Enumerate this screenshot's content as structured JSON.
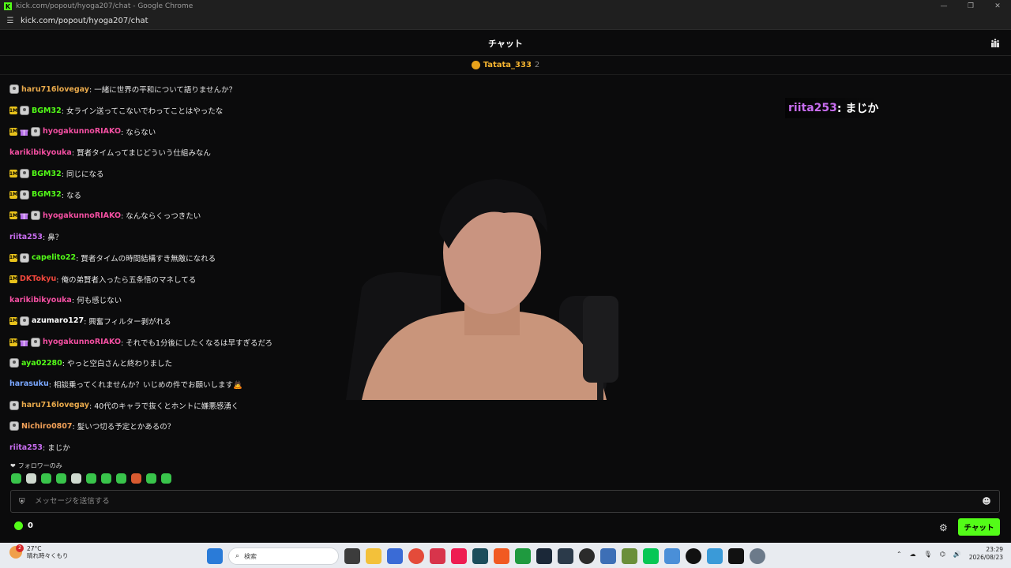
{
  "window": {
    "title": "kick.com/popout/hyoga207/chat - Google Chrome",
    "url": "kick.com/popout/hyoga207/chat"
  },
  "chat": {
    "title": "チャット",
    "pinned": {
      "user": "Tatata_333",
      "count": "2"
    },
    "messages": [
      {
        "user": "haru716lovegay",
        "text": ": 一緒に世界の平和について語りませんか？",
        "color": "#e8a94b",
        "sub": false,
        "gift": false,
        "avatar": true
      },
      {
        "user": "BGM32",
        "text": ": 女ライン送ってこないでわってことはやったな",
        "color": "#53fc18",
        "sub": true,
        "gift": false,
        "avatar": true
      },
      {
        "user": "hyogakunnoRIAKO",
        "text": ": ならない",
        "color": "#f24fa1",
        "sub": true,
        "gift": true,
        "avatar": true
      },
      {
        "user": "karikibikyouka",
        "text": ": 賢者タイムってまじどういう仕組みなん",
        "color": "#f24fa1",
        "sub": false,
        "gift": false,
        "avatar": false
      },
      {
        "user": "BGM32",
        "text": ": 同じになる",
        "color": "#53fc18",
        "sub": true,
        "gift": false,
        "avatar": true
      },
      {
        "user": "BGM32",
        "text": ": なる",
        "color": "#53fc18",
        "sub": true,
        "gift": false,
        "avatar": true
      },
      {
        "user": "hyogakunnoRIAKO",
        "text": ": なんならくっつきたい",
        "color": "#f24fa1",
        "sub": true,
        "gift": true,
        "avatar": true
      },
      {
        "user": "riita253",
        "text": ": 鼻？",
        "color": "#c86df0",
        "sub": false,
        "gift": false,
        "avatar": false
      },
      {
        "user": "capelito22",
        "text": ": 賢者タイムの時間結構すき無敵になれる",
        "color": "#53fc18",
        "sub": true,
        "gift": false,
        "avatar": true
      },
      {
        "user": "DKTokyu",
        "text": ": 俺の弟賢者入ったら五条悟のマネしてる",
        "color": "#f0473c",
        "sub": true,
        "gift": false,
        "avatar": false
      },
      {
        "user": "karikibikyouka",
        "text": ": 何も感じない",
        "color": "#f24fa1",
        "sub": false,
        "gift": false,
        "avatar": false
      },
      {
        "user": "azumaro127",
        "text": ": 興奮フィルター剥がれる",
        "color": "#ffffff",
        "sub": true,
        "gift": false,
        "avatar": true
      },
      {
        "user": "hyogakunnoRIAKO",
        "text": ": それでも1分後にしたくなるは早すぎるだろ",
        "color": "#f24fa1",
        "sub": true,
        "gift": true,
        "avatar": true
      },
      {
        "user": "aya02280",
        "text": ": やっと空白さんと終わりました",
        "color": "#53fc18",
        "sub": false,
        "gift": false,
        "avatar": true
      },
      {
        "user": "harasuku",
        "text": ": 相談乗ってくれませんか？いじめの件でお願いします🙇",
        "color": "#7aa7ff",
        "sub": false,
        "gift": false,
        "avatar": false
      },
      {
        "user": "haru716lovegay",
        "text": ": 40代のキャラで抜くとホントに嫌悪感湧く",
        "color": "#e8a94b",
        "sub": false,
        "gift": false,
        "avatar": true
      },
      {
        "user": "Nichiro0807",
        "text": ": 髪いつ切る予定とかあるの？",
        "color": "#f4a259",
        "sub": false,
        "gift": false,
        "avatar": true
      },
      {
        "user": "riita253",
        "text": ": まじか",
        "color": "#c86df0",
        "sub": false,
        "gift": false,
        "avatar": false
      }
    ],
    "sub_badge_text": "1M",
    "follower_only": "フォロワーのみ",
    "input_placeholder": "メッセージを送信する",
    "points": "0",
    "send_label": "チャット"
  },
  "overlay": {
    "user": "riita253",
    "text": " : まじか"
  },
  "taskbar": {
    "weather_temp": "27°C",
    "weather_desc": "晴れ時々くもり",
    "weather_badge": "2",
    "search_placeholder": "検索",
    "time": "23:29",
    "date": "2026/08/23"
  }
}
